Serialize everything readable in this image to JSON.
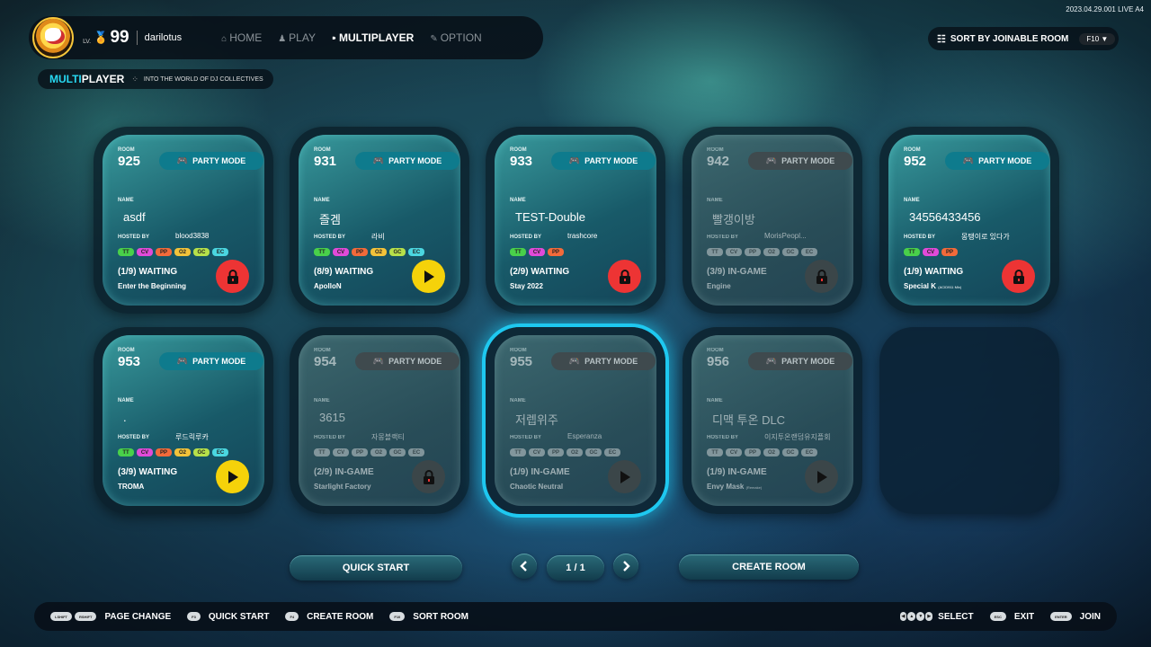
{
  "version": "2023.04.29.001 LIVE A4",
  "player": {
    "lv_label": "LV.",
    "level": "99",
    "username": "darilotus"
  },
  "nav": [
    {
      "icon": "home-icon",
      "glyph": "⌂",
      "label": "HOME"
    },
    {
      "icon": "person-icon",
      "glyph": "♟",
      "label": "PLAY"
    },
    {
      "icon": "signal-icon",
      "glyph": "⁍",
      "label": "MULTIPLAYER"
    },
    {
      "icon": "wrench-icon",
      "glyph": "✎",
      "label": "OPTION"
    }
  ],
  "sort": {
    "label": "SORT BY JOINABLE ROOM",
    "key": "F10"
  },
  "subheader": {
    "part1": "MULTI",
    "part2": "PLAYER",
    "tagline": "INTO THE WORLD OF DJ COLLECTIVES"
  },
  "labels": {
    "room": "ROOM",
    "party_mode": "PARTY MODE",
    "name": "NAME",
    "hosted_by": "HOSTED BY"
  },
  "rooms": [
    {
      "number": "925",
      "name": "asdf",
      "host": "blood3838",
      "tags": [
        "TT",
        "CV",
        "PP",
        "O2",
        "GC",
        "EC"
      ],
      "status": "(1/9) WAITING",
      "song": "Enter the Beginning",
      "song_sub": "",
      "action": "lock",
      "dim": false
    },
    {
      "number": "931",
      "name": "즐겜",
      "host": "라비",
      "tags": [
        "TT",
        "CV",
        "PP",
        "O2",
        "GC",
        "EC"
      ],
      "status": "(8/9) WAITING",
      "song": "ApolloN",
      "song_sub": "",
      "action": "play",
      "dim": false
    },
    {
      "number": "933",
      "name": "TEST-Double",
      "host": "trashcore",
      "tags": [
        "TT",
        "CV",
        "PP"
      ],
      "status": "(2/9) WAITING",
      "song": "Stay 2022",
      "song_sub": "",
      "action": "lock",
      "dim": false
    },
    {
      "number": "942",
      "name": "빨갱이방",
      "host": "MorisPeopl...",
      "tags": [
        "TT",
        "CV",
        "PP",
        "O2",
        "GC",
        "EC"
      ],
      "status": "(3/9) IN-GAME",
      "song": "Engine",
      "song_sub": "",
      "action": "lock",
      "dim": true
    },
    {
      "number": "952",
      "name": "34556433456",
      "host": "몽탱이로 있다가",
      "tags": [
        "TT",
        "CV",
        "PP"
      ],
      "status": "(1/9) WAITING",
      "song": "Special K",
      "song_sub": "(ACID911 Mix)",
      "action": "lock",
      "dim": false
    },
    {
      "number": "953",
      "name": ".",
      "host": "루드릭루카",
      "tags": [
        "TT",
        "CV",
        "PP",
        "O2",
        "GC",
        "EC"
      ],
      "status": "(3/9) WAITING",
      "song": "TROMA",
      "song_sub": "",
      "action": "play",
      "dim": false
    },
    {
      "number": "954",
      "name": "3615",
      "host": "자몽블랙티",
      "tags": [
        "TT",
        "CV",
        "PP",
        "O2",
        "GC",
        "EC"
      ],
      "status": "(2/9) IN-GAME",
      "song": "Starlight Factory",
      "song_sub": "",
      "action": "lock",
      "dim": true
    },
    {
      "number": "955",
      "name": "저렙위주",
      "host": "Esperanza",
      "tags": [
        "TT",
        "CV",
        "PP",
        "O2",
        "GC",
        "EC"
      ],
      "status": "(1/9) IN-GAME",
      "song": "Chaotic Neutral",
      "song_sub": "",
      "action": "play",
      "dim": true,
      "selected": true
    },
    {
      "number": "956",
      "name": "디맥 투온 DLC",
      "host": "이지투온랜덤유지플회",
      "tags": [
        "TT",
        "CV",
        "PP",
        "O2",
        "GC",
        "EC"
      ],
      "status": "(1/9) IN-GAME",
      "song": "Envy Mask",
      "song_sub": "(Remake)",
      "action": "play",
      "dim": true
    }
  ],
  "controls": {
    "quick_start": "QUICK START",
    "page": "1 / 1",
    "create_room": "CREATE ROOM"
  },
  "footer": {
    "left": [
      {
        "keys": [
          "LSHIFT",
          "RSHIFT"
        ],
        "label": "PAGE CHANGE"
      },
      {
        "keys": [
          "F3"
        ],
        "label": "QUICK START"
      },
      {
        "keys": [
          "F4"
        ],
        "label": "CREATE ROOM"
      },
      {
        "keys": [
          "F10"
        ],
        "label": "SORT ROOM"
      }
    ],
    "select_label": "SELECT",
    "exit_key": "ESC",
    "exit_label": "EXIT",
    "join_key": "ENTER",
    "join_label": "JOIN"
  }
}
